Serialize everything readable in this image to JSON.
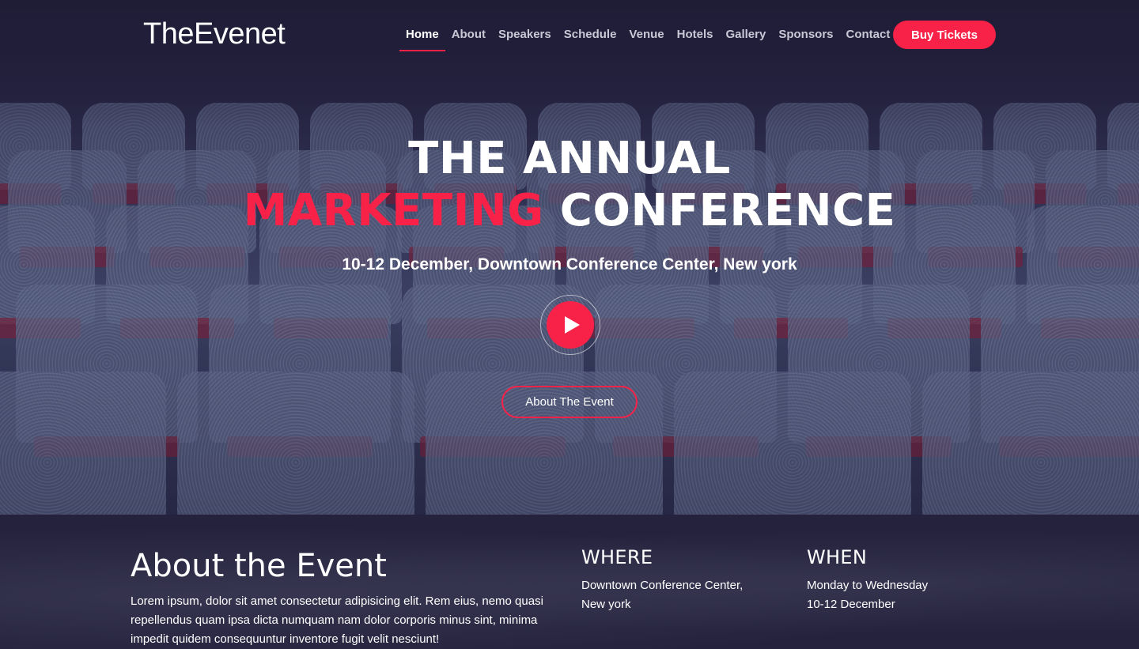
{
  "header": {
    "logo": "TheEvenet",
    "nav": [
      "Home",
      "About",
      "Speakers",
      "Schedule",
      "Venue",
      "Hotels",
      "Gallery",
      "Sponsors",
      "Contact"
    ],
    "active_nav": "Home",
    "cta": "Buy Tickets"
  },
  "hero": {
    "title_line1": "THE ANNUAL",
    "title_accent": "MARKETING",
    "title_rest": " CONFERENCE",
    "subtitle": "10-12 December, Downtown Conference Center, New york",
    "play_icon": "play-icon",
    "about_button": "About The Event"
  },
  "about": {
    "title": "About the Event",
    "text": "Lorem ipsum, dolor sit amet consectetur adipisicing elit. Rem eius, nemo quasi repellendus quam ipsa dicta numquam nam dolor corporis minus sint, minima impedit quidem consequuntur inventore fugit velit nesciunt!",
    "where_heading": "WHERE",
    "where_text": "Downtown Conference Center, New york",
    "when_heading": "WHEN",
    "when_line1": "Monday to Wednesday",
    "when_line2": "10-12 December"
  },
  "colors": {
    "accent": "#f82249",
    "background": "#1c1a33"
  }
}
